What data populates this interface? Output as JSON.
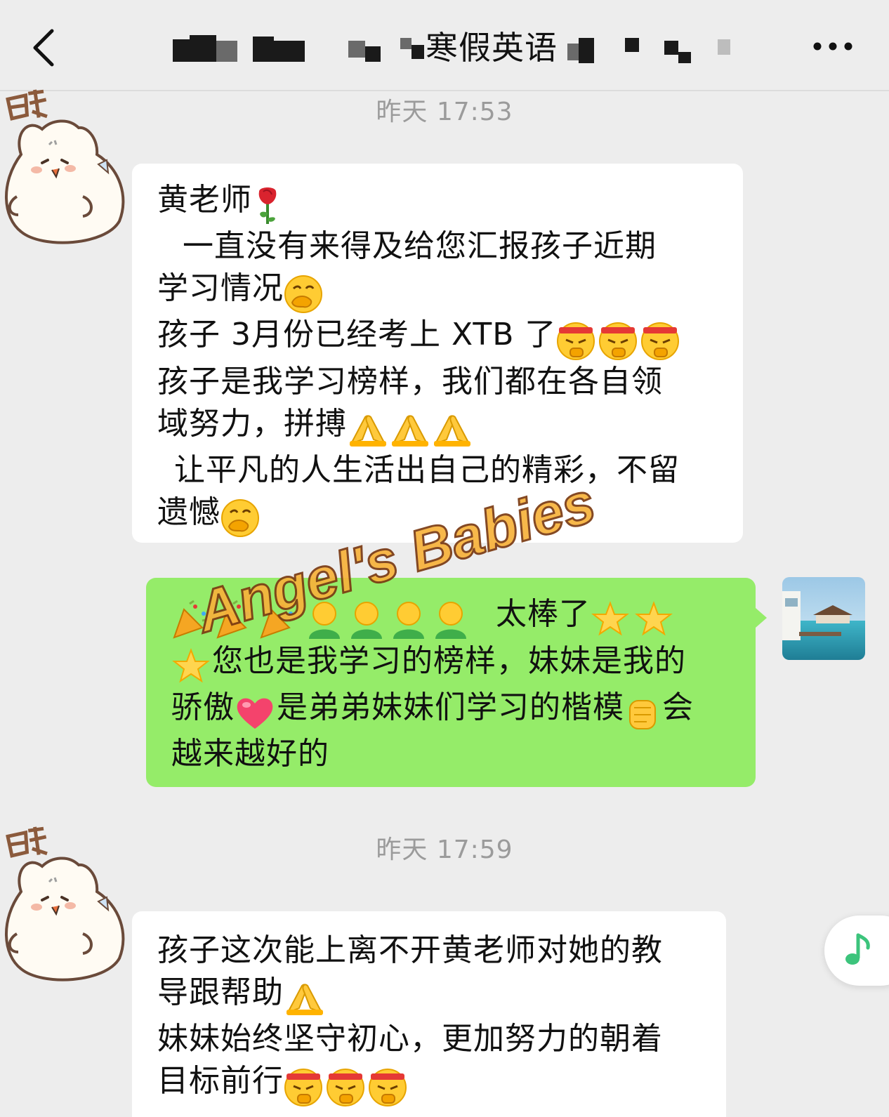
{
  "header": {
    "title": "寒假英语",
    "back_icon": "chevron-left-icon",
    "more_icon": "more-horizontal-icon"
  },
  "messages": [
    {
      "timestamp": "昨天 17:53",
      "sender": "incoming",
      "avatar_badge": "晒",
      "lines": [
        "黄老师",
        "一直没有来得及给您汇报孩子近期",
        "学习情况",
        "孩子 3月份已经考上 XTB 了",
        "孩子是我学习榜样，我们都在各自领",
        "域努力，拼搏",
        "让平凡的人生活出自己的精彩，不留",
        "遗憾"
      ]
    },
    {
      "sender": "outgoing",
      "lines": [
        "太棒了",
        "您也是我学习的榜样，妹妹是我的",
        "骄傲",
        "是弟弟妹妹们学习的楷模",
        "会",
        "越来越好的"
      ]
    },
    {
      "timestamp": "昨天 17:59",
      "sender": "incoming",
      "avatar_badge": "晒",
      "lines": [
        "孩子这次能上离不开黄老师对她的教",
        "导跟帮助",
        "妹妹始终坚守初心，更加努力的朝着",
        "目标前行"
      ]
    }
  ],
  "watermark": "Angel's Babies",
  "floating_button": {
    "icon": "music-note-icon",
    "color": "#3CC47C"
  },
  "colors": {
    "background": "#EDEDED",
    "incoming_bubble": "#FFFFFF",
    "outgoing_bubble": "#95EC69",
    "timestamp_text": "#9B9B9B"
  }
}
